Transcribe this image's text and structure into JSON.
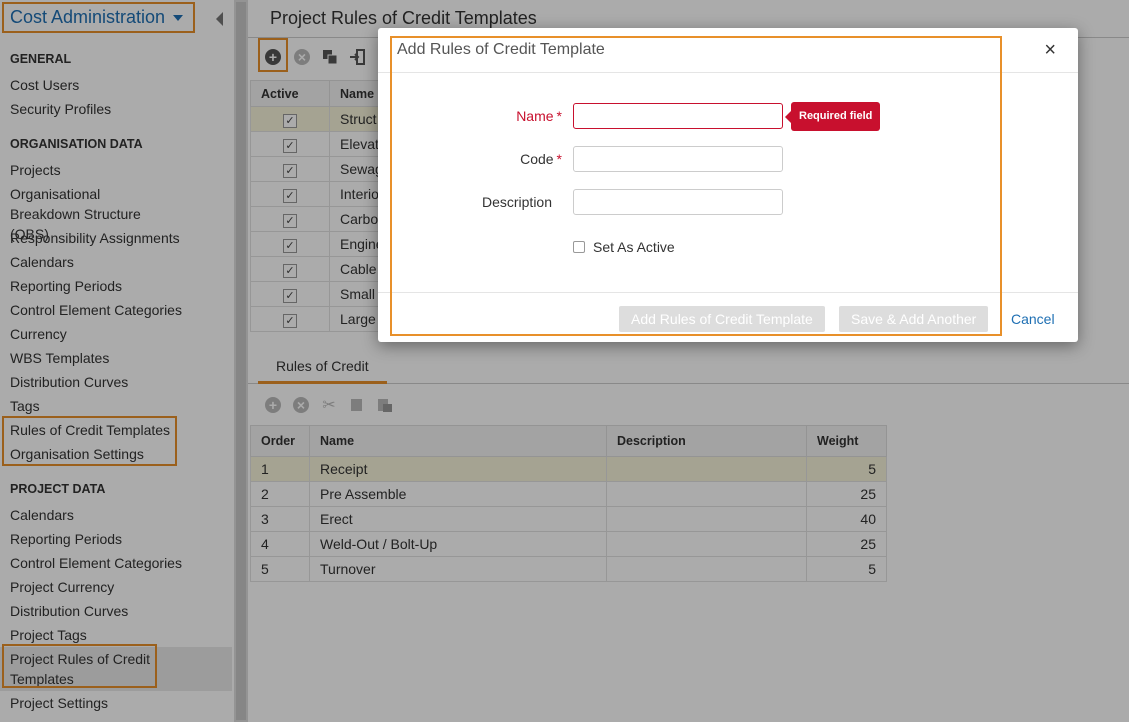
{
  "sidebar": {
    "title": "Cost Administration",
    "sections": [
      {
        "heading": "GENERAL",
        "items": [
          "Cost Users",
          "Security Profiles"
        ]
      },
      {
        "heading": "ORGANISATION DATA",
        "items": [
          "Projects",
          "Organisational Breakdown Structure (OBS)",
          "Responsibility Assignments",
          "Calendars",
          "Reporting Periods",
          "Control Element Categories",
          "Currency",
          "WBS Templates",
          "Distribution Curves",
          "Tags",
          "Rules of Credit Templates",
          "Organisation Settings"
        ]
      },
      {
        "heading": "PROJECT DATA",
        "items": [
          "Calendars",
          "Reporting Periods",
          "Control Element Categories",
          "Project Currency",
          "Distribution Curves",
          "Project Tags",
          "Project Rules of Credit Templates",
          "Project Settings"
        ]
      }
    ]
  },
  "main": {
    "title": "Project Rules of Credit Templates",
    "grid": {
      "columns": [
        "Active",
        "Name"
      ],
      "rows": [
        {
          "active": true,
          "name": "Struct"
        },
        {
          "active": true,
          "name": "Elevat"
        },
        {
          "active": true,
          "name": "Sewag"
        },
        {
          "active": true,
          "name": "Interio"
        },
        {
          "active": true,
          "name": "Carbo"
        },
        {
          "active": true,
          "name": "Engine"
        },
        {
          "active": true,
          "name": "Cable"
        },
        {
          "active": true,
          "name": "Small"
        },
        {
          "active": true,
          "name": "Large"
        }
      ]
    },
    "tab": "Rules of Credit",
    "rules_grid": {
      "columns": [
        "Order",
        "Name",
        "Description",
        "Weight"
      ],
      "rows": [
        {
          "order": "1",
          "name": "Receipt",
          "description": "",
          "weight": "5"
        },
        {
          "order": "2",
          "name": "Pre Assemble",
          "description": "",
          "weight": "25"
        },
        {
          "order": "3",
          "name": "Erect",
          "description": "",
          "weight": "40"
        },
        {
          "order": "4",
          "name": "Weld-Out / Bolt-Up",
          "description": "",
          "weight": "25"
        },
        {
          "order": "5",
          "name": "Turnover",
          "description": "",
          "weight": "5"
        }
      ]
    }
  },
  "modal": {
    "title": "Add Rules of Credit Template",
    "close_symbol": "×",
    "fields": {
      "name_label": "Name",
      "code_label": "Code",
      "description_label": "Description",
      "required_mark": "*",
      "name_value": "",
      "code_value": "",
      "description_value": ""
    },
    "tooltip": "Required field",
    "set_active_label": "Set As Active",
    "buttons": {
      "add": "Add Rules of Credit Template",
      "save_add_another": "Save & Add Another",
      "cancel": "Cancel"
    }
  },
  "colors": {
    "accent": "#1e6fb3",
    "highlight": "#e8902a",
    "error": "#c8102e",
    "selected_row": "#f6f4da"
  }
}
